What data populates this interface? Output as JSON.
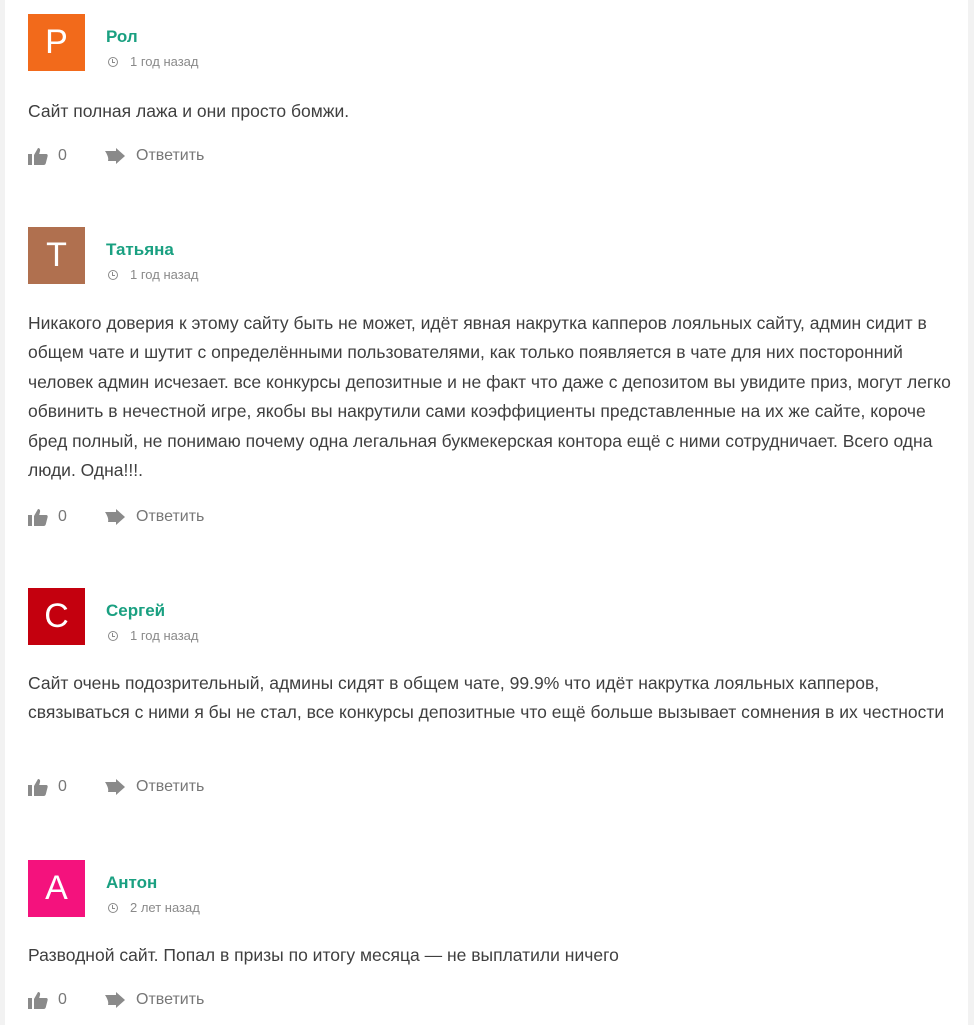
{
  "comments": [
    {
      "initial": "Р",
      "avatar_color": "#f26a1b",
      "author": "Рол",
      "time": "1 год назад",
      "text": "Сайт полная лажа и они просто бомжи.",
      "likes": "0",
      "reply_label": "Ответить"
    },
    {
      "initial": "Т",
      "avatar_color": "#b0704f",
      "author": "Татьяна",
      "time": "1 год назад",
      "text": "Никакого доверия к этому сайту быть не может, идёт явная накрутка капперов лояльных сайту, админ сидит в общем чате и шутит с определёнными пользователями, как только появляется в чате для них посторонний человек админ исчезает. все конкурсы депозитные и не факт что даже с депозитом вы увидите приз, могут легко обвинить в нечестной игре, якобы вы накрутили сами коэффициенты представленные на их же сайте, короче бред полный, не понимаю почему одна легальная букмекерская контора ещё с ними сотрудничает. Всего одна люди. Одна!!!.",
      "likes": "0",
      "reply_label": "Ответить"
    },
    {
      "initial": "С",
      "avatar_color": "#c4000e",
      "author": "Сергей",
      "time": "1 год назад",
      "text": "Сайт очень подозрительный, админы сидят в общем чате, 99.9% что идёт накрутка лояльных капперов, связываться с ними я бы не стал, все конкурсы депозитные что ещё больше вызывает сомнения в их честности",
      "likes": "0",
      "reply_label": "Ответить"
    },
    {
      "initial": "А",
      "avatar_color": "#f4127d",
      "author": "Антон",
      "time": "2 лет назад",
      "text": "Разводной сайт. Попал в призы по итогу месяца — не выплатили ничего",
      "likes": "0",
      "reply_label": "Ответить"
    }
  ]
}
